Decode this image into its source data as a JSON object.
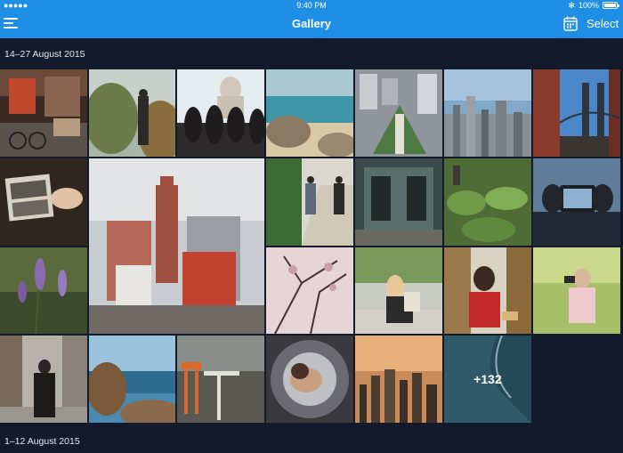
{
  "status_bar": {
    "signal_text": "●●●●● ",
    "time": "9:40 PM",
    "battery_text": "100%"
  },
  "nav": {
    "title": "Gallery",
    "select_label": "Select"
  },
  "sections": [
    {
      "date_range": "14–27 August 2015",
      "photos": [
        {
          "subject": "cafe-street-bicycles"
        },
        {
          "subject": "man-standing-in-field"
        },
        {
          "subject": "people-viewing-capitol-dome"
        },
        {
          "subject": "rocky-beach-coast"
        },
        {
          "subject": "aerial-city-park"
        },
        {
          "subject": "city-skyline-haze"
        },
        {
          "subject": "brooklyn-bridge-brick-building"
        },
        {
          "subject": "hand-holding-old-photos"
        },
        {
          "subject": "city-buildings-red-brick"
        },
        {
          "subject": "couple-walking-hedge-path"
        },
        {
          "subject": "storefront-people"
        },
        {
          "subject": "market-vegetables"
        },
        {
          "subject": "hands-holding-phone-camera"
        },
        {
          "subject": "purple-flowers"
        },
        {
          "subject": "pink-blossom-branches"
        },
        {
          "subject": "woman-sitting-with-child"
        },
        {
          "subject": "woman-red-dress-window"
        },
        {
          "subject": "girl-with-camera-grass"
        },
        {
          "subject": "man-walking-street"
        },
        {
          "subject": "coastal-rocks-sea"
        },
        {
          "subject": "orange-chairs-cafe-table"
        },
        {
          "subject": "woman-lying-in-tire"
        },
        {
          "subject": "city-skyline-sunset"
        },
        {
          "subject": "aerial-ocean-coast"
        }
      ],
      "more_count_label": "+132"
    },
    {
      "date_range": "1–12 August 2015"
    }
  ],
  "colors": {
    "nav_background": "#1e8fe4",
    "page_background": "#121a2b"
  }
}
